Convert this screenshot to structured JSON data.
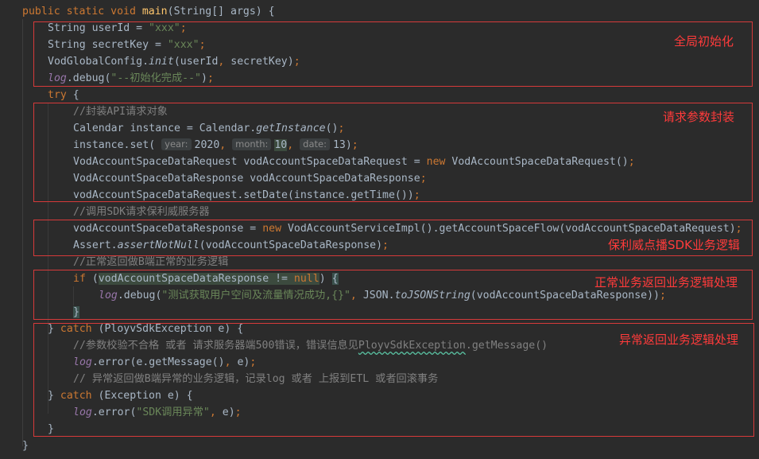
{
  "editor": {
    "code_lines": [
      {
        "indent": 0,
        "tokens": [
          {
            "t": "public static void ",
            "c": "kw"
          },
          {
            "t": "main",
            "c": "fn"
          },
          {
            "t": "(String[] args) {"
          }
        ]
      },
      {
        "indent": 1,
        "tokens": [
          {
            "t": "String userId = "
          },
          {
            "t": "\"xxx\"",
            "c": "str"
          },
          {
            "t": ";",
            "c": "kw"
          }
        ]
      },
      {
        "indent": 1,
        "tokens": [
          {
            "t": "String secretKey = "
          },
          {
            "t": "\"xxx\"",
            "c": "str"
          },
          {
            "t": ";",
            "c": "kw"
          }
        ]
      },
      {
        "indent": 1,
        "tokens": [
          {
            "t": "VodGlobalConfig."
          },
          {
            "t": "init",
            "c": "it"
          },
          {
            "t": "(userId"
          },
          {
            "t": ", ",
            "c": "kw"
          },
          {
            "t": "secretKey)"
          },
          {
            "t": ";",
            "c": "kw"
          }
        ]
      },
      {
        "indent": 1,
        "tokens": [
          {
            "t": "log",
            "c": "fld it"
          },
          {
            "t": ".debug("
          },
          {
            "t": "\"--初始化完成--\"",
            "c": "str"
          },
          {
            "t": ")"
          },
          {
            "t": ";",
            "c": "kw"
          }
        ]
      },
      {
        "indent": 1,
        "tokens": [
          {
            "t": "try ",
            "c": "kw"
          },
          {
            "t": "{"
          }
        ]
      },
      {
        "indent": 2,
        "tokens": [
          {
            "t": "//封装API请求对象",
            "c": "cm"
          }
        ]
      },
      {
        "indent": 2,
        "tokens": [
          {
            "t": "Calendar instance = Calendar."
          },
          {
            "t": "getInstance",
            "c": "it"
          },
          {
            "t": "()"
          },
          {
            "t": ";",
            "c": "kw"
          }
        ]
      },
      {
        "indent": 2,
        "tokens": [
          {
            "t": "instance.set( "
          },
          {
            "t": "year:",
            "c": "hint"
          },
          {
            "t": "2020"
          },
          {
            "t": ", ",
            "c": "kw"
          },
          {
            "t": "month:",
            "c": "hint"
          },
          {
            "t": "10",
            "c": "hl"
          },
          {
            "t": ", ",
            "c": "kw"
          },
          {
            "t": "date:",
            "c": "hint"
          },
          {
            "t": "13)"
          },
          {
            "t": ";",
            "c": "kw"
          }
        ]
      },
      {
        "indent": 2,
        "tokens": [
          {
            "t": "VodAccountSpaceDataRequest vodAccountSpaceDataRequest = "
          },
          {
            "t": "new ",
            "c": "kw"
          },
          {
            "t": "VodAccountSpaceDataRequest()"
          },
          {
            "t": ";",
            "c": "kw"
          }
        ]
      },
      {
        "indent": 2,
        "tokens": [
          {
            "t": "VodAccountSpaceDataResponse vodAccountSpaceDataResponse"
          },
          {
            "t": ";",
            "c": "kw"
          }
        ]
      },
      {
        "indent": 2,
        "tokens": [
          {
            "t": "vodAccountSpaceDataRequest.setDate(instance.getTime())"
          },
          {
            "t": ";",
            "c": "kw"
          }
        ]
      },
      {
        "indent": 2,
        "tokens": [
          {
            "t": "//调用SDK请求保利威服务器",
            "c": "cm"
          }
        ]
      },
      {
        "indent": 2,
        "tokens": [
          {
            "t": "vodAccountSpaceDataResponse = "
          },
          {
            "t": "new ",
            "c": "kw"
          },
          {
            "t": "VodAccountServiceImpl().getAccountSpaceFlow(vodAccountSpaceDataRequest)"
          },
          {
            "t": ";",
            "c": "kw"
          }
        ]
      },
      {
        "indent": 2,
        "tokens": [
          {
            "t": "Assert."
          },
          {
            "t": "assertNotNull",
            "c": "it"
          },
          {
            "t": "(vodAccountSpaceDataResponse)"
          },
          {
            "t": ";",
            "c": "kw"
          }
        ]
      },
      {
        "indent": 2,
        "tokens": [
          {
            "t": "//正常返回做B端正常的业务逻辑",
            "c": "cm"
          }
        ]
      },
      {
        "indent": 2,
        "tokens": [
          {
            "t": "if ",
            "c": "kw"
          },
          {
            "t": "("
          },
          {
            "t": "vodAccountSpaceDataResponse != ",
            "c": "hl"
          },
          {
            "t": "null",
            "c": "kw hl"
          },
          {
            "t": ") "
          },
          {
            "t": "{",
            "c": "hlbrace"
          }
        ]
      },
      {
        "indent": 3,
        "tokens": [
          {
            "t": "log",
            "c": "fld it"
          },
          {
            "t": ".debug("
          },
          {
            "t": "\"测试获取用户空间及流量情况成功,{}\"",
            "c": "str"
          },
          {
            "t": ", ",
            "c": "kw"
          },
          {
            "t": "JSON."
          },
          {
            "t": "toJSONString",
            "c": "it"
          },
          {
            "t": "(vodAccountSpaceDataResponse))"
          },
          {
            "t": ";",
            "c": "kw"
          }
        ]
      },
      {
        "indent": 2,
        "tokens": [
          {
            "t": "}",
            "c": "hlbrace"
          }
        ]
      },
      {
        "indent": 1,
        "tokens": [
          {
            "t": "} "
          },
          {
            "t": "catch ",
            "c": "kw"
          },
          {
            "t": "(PloyvSdkException e) {"
          }
        ]
      },
      {
        "indent": 2,
        "tokens": [
          {
            "t": "//参数校验不合格 或者 请求服务器端500错误，错误信息见",
            "c": "cm"
          },
          {
            "t": "PloyvSdkException",
            "c": "cm squig"
          },
          {
            "t": ".getMessage()",
            "c": "cm"
          }
        ]
      },
      {
        "indent": 2,
        "tokens": [
          {
            "t": "log",
            "c": "fld it"
          },
          {
            "t": ".error(e.getMessage()"
          },
          {
            "t": ", ",
            "c": "kw"
          },
          {
            "t": "e)"
          },
          {
            "t": ";",
            "c": "kw"
          }
        ]
      },
      {
        "indent": 2,
        "tokens": [
          {
            "t": "// 异常返回做B端异常的业务逻辑，记录log 或者 上报到ETL 或者回滚事务",
            "c": "cm"
          }
        ]
      },
      {
        "indent": 1,
        "tokens": [
          {
            "t": "} "
          },
          {
            "t": "catch ",
            "c": "kw"
          },
          {
            "t": "(Exception e) {"
          }
        ]
      },
      {
        "indent": 2,
        "tokens": [
          {
            "t": "log",
            "c": "fld it"
          },
          {
            "t": ".error("
          },
          {
            "t": "\"SDK调用异常\"",
            "c": "str"
          },
          {
            "t": ", ",
            "c": "kw"
          },
          {
            "t": "e)"
          },
          {
            "t": ";",
            "c": "kw"
          }
        ]
      },
      {
        "indent": 1,
        "tokens": [
          {
            "t": "}"
          }
        ]
      },
      {
        "indent": 0,
        "tokens": [
          {
            "t": "}"
          }
        ]
      }
    ]
  },
  "annotations": {
    "global_init": "全局初始化",
    "request_params": "请求参数封装",
    "sdk_logic": "保利威点播SDK业务逻辑",
    "normal_handling": "正常业务返回业务逻辑处理",
    "exception_handling": "异常返回业务逻辑处理"
  },
  "colors": {
    "background": "#2b2b2b",
    "annotation_red": "#ff3b3b",
    "keyword": "#cc7832",
    "string": "#6a8759",
    "comment": "#808080",
    "field": "#9876aa"
  }
}
